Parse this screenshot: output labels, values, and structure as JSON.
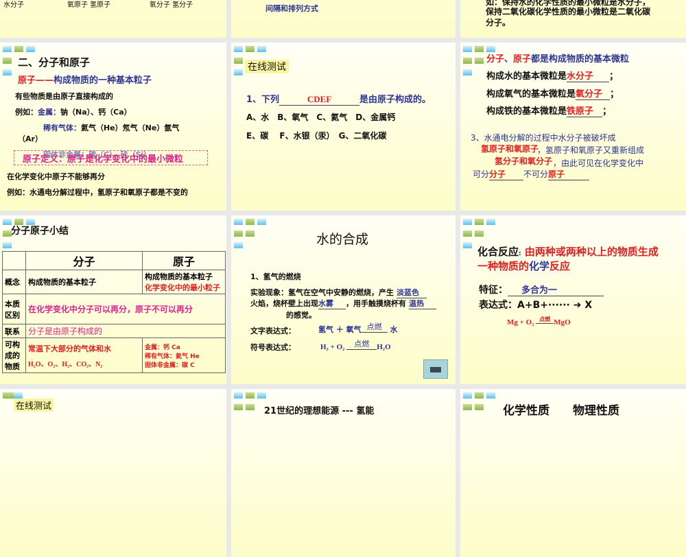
{
  "slides": [
    {
      "top_text": [
        "水分子",
        "氧原子 氢原子",
        "氧分子 氢分子"
      ]
    },
    {
      "top_text": "间隔和排列方式"
    },
    {
      "top_text": [
        "如：保持水的化学性质的最小微粒是水分子，",
        "保持二氧化碳化学性质的最小微粒是二氧化碳",
        "分子。"
      ]
    },
    {
      "title": "二、分子和原子",
      "sub_red": "原子——",
      "sub_blue": "构成物质的一种基本粒子",
      "l1": "有些物质是由原子直接构成的",
      "l2a": "例如：",
      "l2b": "金属：",
      "l2c": "钠（Na）、钙（Ca）",
      "l3a": "稀有气体：",
      "l3b": "氦气（He）氖气（Ne）氩气",
      "l3c": "（Ar）",
      "l4": "固体非金属：碳（C）、硅（Si）",
      "boxed": "原子定义：原子是化学变化中的最小微粒",
      "l5": "在化学变化中原子不能够再分",
      "l6": "例如：水通电分解过程中，氢原子和氧原子都是不变的"
    },
    {
      "tag": "在线测试",
      "q1a": "1、下列",
      "q1ans": "CDEF",
      "q1b": "是由原子构成的。",
      "opts1": "A、水　B、氧气　C、氦气　D、金属钙",
      "opts2": "E、碳　 F、水银（汞）　G、二氧化碳"
    },
    {
      "head_red1": "分子",
      "sep": "、",
      "head_red2": "原子",
      "head_blue": "都是构成物质的基本微粒",
      "r1": "构成水的基本微粒是",
      "a1": "水分子",
      "r2": "构成氧气的基本微粒是",
      "a2": "氧分子",
      "r3": "构成铁的基本微粒是",
      "a3": "铁原子",
      "semi": "；",
      "q3l1": "3、水通电分解的过程中水分子被破坏成",
      "q3a1": "氢原子和氧原子",
      "q3l2": "，氢原子和氧原子又重新组成",
      "q3a2": "氢分子和氧分子",
      "q3l3": "，由此可见在化学变化中",
      "q3l4a": "可分",
      "q3a3": "分子",
      "q3l4b": "不可分",
      "q3a4": "原子"
    },
    {
      "title": "分子原子小结",
      "cols": [
        "分子",
        "原子"
      ],
      "rows": [
        {
          "label": "概念",
          "mol": "构成物质的基本粒子",
          "atom1": "构成物质的基本粒子",
          "atom2": "化学变化中的最小粒子"
        },
        {
          "label": "本质区别",
          "both": "在化学变化中分子可以再分，原子不可以再分"
        },
        {
          "label": "联系",
          "both": "分子是由原子构成的"
        },
        {
          "label": "可构成的物质",
          "mol1": "常温下大部分的气体和水",
          "mol2": "H₂O、O₂、H₂、CO₂、N₂",
          "atom1": "金属：钙 Ca",
          "atom2": "稀有气体：氦气 He",
          "atom3": "固体非金属：碳 C"
        }
      ]
    },
    {
      "title": "水的合成",
      "s1": "1、氢气的燃烧",
      "e1": "实验现象：氢气在空气中安静的燃烧，产生",
      "a1": "淡蓝色",
      "e2a": "火焰，烧杯壁上出现",
      "a2": "水雾",
      "e2b": "，用手触摸烧杯有",
      "a3": "温热",
      "e3": "的感觉。",
      "w_label": "文字表达式：",
      "w_eq_a": "氢气 ＋ 氧气",
      "cond": "点燃",
      "w_eq_b": "水",
      "s_label": "符号表达式：",
      "s_eq_a": "H₂ + O₂",
      "s_eq_b": "H₂O"
    },
    {
      "term": "化合反应",
      "colon": ":",
      "def1": "由两种或两种以上的物质生成",
      "def2a": "一种物质的",
      "def2b": "化学",
      "def2c": "反应",
      "feat_label": "特征：",
      "feat": "多合为一",
      "expr_label": "表达式：",
      "expr": "A+B+······ ➜ X",
      "eq_a": "Mg +  O₂",
      "cond": "点燃",
      "eq_b": "MgO"
    },
    {
      "tag": "在线测试"
    },
    {
      "title": "21世纪的理想能源 --- 氢能"
    },
    {
      "title": "化学性质　　物理性质"
    }
  ]
}
